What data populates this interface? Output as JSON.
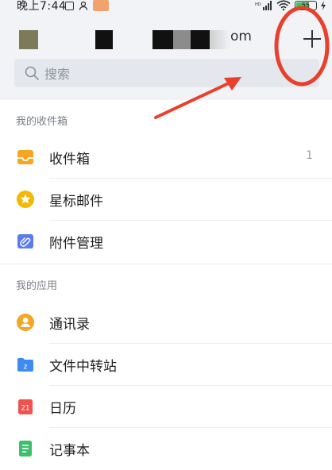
{
  "status_bar": {
    "time_prefix": "晚上",
    "time": "7:44",
    "battery": "55"
  },
  "header": {
    "account_suffix": "om",
    "add_label": "+",
    "search_placeholder": "搜索"
  },
  "sections": [
    {
      "title": "我的收件箱",
      "items": [
        {
          "label": "收件箱",
          "icon": "inbox-icon",
          "count": "1",
          "color": "#f5a623"
        },
        {
          "label": "星标邮件",
          "icon": "star-icon",
          "count": "",
          "color": "#f5b800"
        },
        {
          "label": "附件管理",
          "icon": "attachment-icon",
          "count": "",
          "color": "#5b7cf0"
        }
      ]
    },
    {
      "title": "我的应用",
      "items": [
        {
          "label": "通讯录",
          "icon": "contacts-icon",
          "count": "",
          "color": "#f5a623"
        },
        {
          "label": "文件中转站",
          "icon": "folder-icon",
          "count": "",
          "color": "#3d8bef"
        },
        {
          "label": "日历",
          "icon": "calendar-icon",
          "count": "",
          "color": "#f0524f",
          "icon_text": "21"
        },
        {
          "label": "记事本",
          "icon": "notepad-icon",
          "count": "",
          "color": "#3cbf6b"
        }
      ]
    }
  ],
  "annotation": {
    "color": "#e8402c"
  }
}
